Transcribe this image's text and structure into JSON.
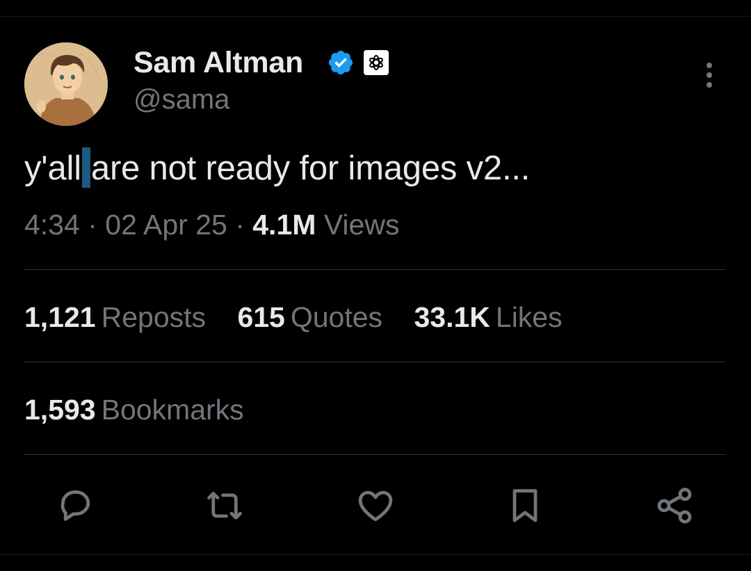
{
  "author": {
    "display_name": "Sam Altman",
    "handle": "@sama"
  },
  "tweet": {
    "text_before_cursor": "y'all",
    "text_after_cursor": "are not ready for images v2..."
  },
  "meta": {
    "time": "4:34",
    "date": "02 Apr 25",
    "views_count": "4.1M",
    "views_label": "Views"
  },
  "stats": {
    "reposts_count": "1,121",
    "reposts_label": "Reposts",
    "quotes_count": "615",
    "quotes_label": "Quotes",
    "likes_count": "33.1K",
    "likes_label": "Likes",
    "bookmarks_count": "1,593",
    "bookmarks_label": "Bookmarks"
  },
  "actions": [
    "reply-icon",
    "repost-icon",
    "like-icon",
    "bookmark-icon",
    "share-icon"
  ],
  "colors": {
    "background": "#000000",
    "text_primary": "#e7e9ea",
    "text_secondary": "#71767b",
    "verified": "#1d9bf0",
    "divider": "#2f3336"
  }
}
